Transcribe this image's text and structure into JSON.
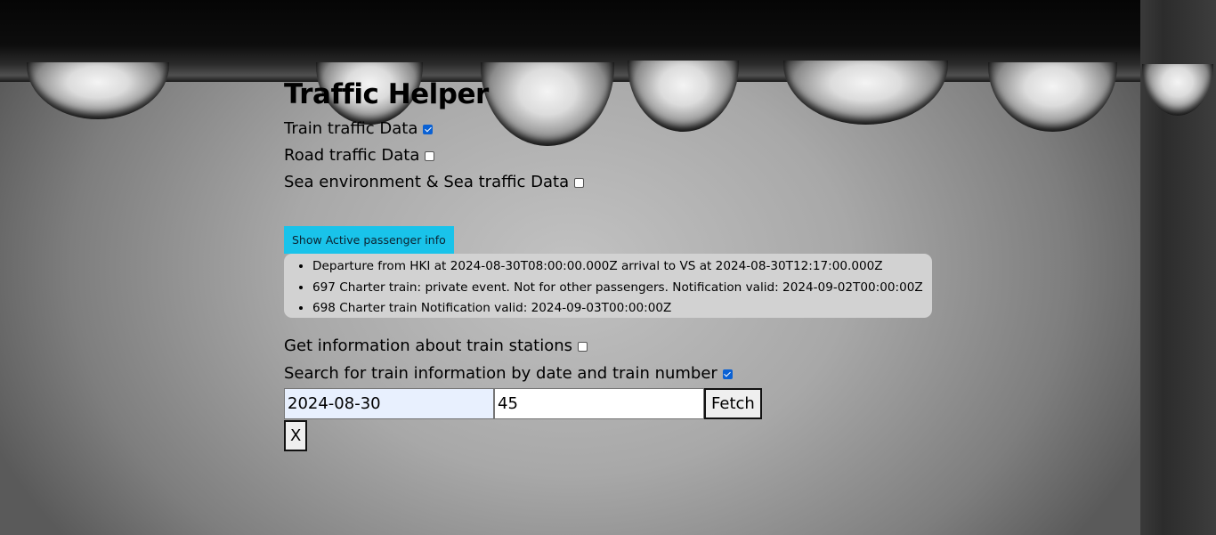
{
  "app": {
    "title": "Traffic Helper"
  },
  "options": [
    {
      "label": "Train traffic Data",
      "checked": true
    },
    {
      "label": "Road traffic Data",
      "checked": false
    },
    {
      "label": "Sea environment & Sea traffic Data",
      "checked": false
    }
  ],
  "passenger": {
    "button_label": "Show Active passenger info",
    "items": [
      "Departure from HKI at 2024-08-30T08:00:00.000Z arrival to VS at 2024-08-30T12:17:00.000Z",
      "697 Charter train: private event. Not for other passengers. Notification valid: 2024-09-02T00:00:00Z",
      "698 Charter train Notification valid: 2024-09-03T00:00:00Z"
    ]
  },
  "stations": {
    "label": "Get information about train stations",
    "checked": false
  },
  "search": {
    "label": "Search for train information by date and train number",
    "checked": true,
    "date_value": "2024-08-30",
    "train_number_value": "45",
    "fetch_label": "Fetch",
    "clear_label": "X"
  },
  "colors": {
    "accent_button": "#19c3ea",
    "checkbox_checked": "#0a61d4",
    "info_box_bg": "#d2d2d2",
    "date_input_bg": "#e8f0fe"
  }
}
